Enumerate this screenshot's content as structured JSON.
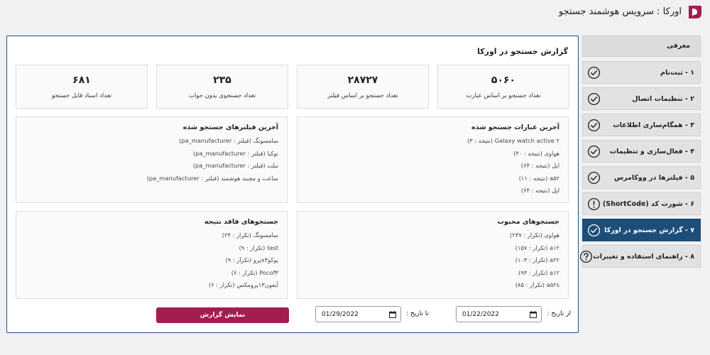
{
  "app": {
    "title": "اورکا : سرویس هوشمند جستجو"
  },
  "sidebar": {
    "header": "معرفی",
    "items": [
      {
        "label": "۱ - ثبت‌نام",
        "icon": "check-circle-icon",
        "active": false
      },
      {
        "label": "۲ - تنظیمات اتصال",
        "icon": "check-circle-icon",
        "active": false
      },
      {
        "label": "۳ - همگام‌سازی اطلاعات",
        "icon": "check-circle-icon",
        "active": false
      },
      {
        "label": "۴ - فعال‌سازی و تنظیمات",
        "icon": "check-circle-icon",
        "active": false
      },
      {
        "label": "۵ - فیلترها در ووکامرس",
        "icon": "check-circle-icon",
        "active": false
      },
      {
        "label": "۶ - شورت کد (ShortCode)",
        "icon": "exclamation-circle-icon",
        "active": false
      },
      {
        "label": "۷ - گزارش جستجو در اورکا",
        "icon": "check-circle-icon",
        "active": true
      },
      {
        "label": "۸ - راهنمای استفاده و تغییرات",
        "icon": "question-circle-icon",
        "active": false
      }
    ]
  },
  "main": {
    "title": "گزارش جستجو در اورکا",
    "stats": [
      {
        "value": "۵۰۶۰",
        "label": "تعداد جستجو بر اساس عبارت"
      },
      {
        "value": "۲۸۷۲۷",
        "label": "تعداد جستجو بر اساس فیلتر"
      },
      {
        "value": "۲۳۵",
        "label": "تعداد جستجوی بدون جواب"
      },
      {
        "value": "۶۸۱",
        "label": "تعداد اسناد قابل جستجو"
      }
    ],
    "latest_phrases": {
      "title": "آخرین عبارات جستجو شده",
      "rows": [
        "Galaxy watch active ۲ (نتیجه : ۳)",
        "هواوی (نتیجه : ۴۰)",
        "اپل (نتیجه : ۶۴)",
        "a۵۲ (نتیجه : ۱۱)",
        "اپل (نتیجه : ۶۴)"
      ]
    },
    "latest_filters": {
      "title": "آخرین فیلترهای جستجو شده",
      "rows": [
        "سامسونگ (فیلتر : pa_manufacturer)",
        "نوکیا (فیلتر : pa_manufacturer)",
        "تبلت (فیلتر : pa_manufacturer)",
        "ساعت و مچبند هوشمند (فیلتر : pa_manufacturer)"
      ]
    },
    "popular": {
      "title": "جستجوهای محبوب",
      "rows": [
        "هواوی (تکرار : ۲۳۷)",
        "a۱۲ (تکرار : ۱۵۷)",
        "a۲۲ (تکرار : ۱۰۳)",
        "a۱۲ (تکرار : ۹۳)",
        "a۵۲s (تکرار : ۸۵)"
      ]
    },
    "no_result": {
      "title": "جستجوهای فاقد نتیجه",
      "rows": [
        "سامسونگ (تکرار : ۲۴)",
        "test (تکرار : ۹)",
        "پوکوx۳پرو (تکرار : ۹)",
        "Pocof۳ (تکرار : ۶)",
        "آیفون۱۳پرومکس (تکرار : ۶)"
      ]
    },
    "filter": {
      "from_label": "از تاریخ :",
      "from_value": "01/22/2022",
      "to_label": "تا تاریخ :",
      "to_value": "01/29/2022",
      "submit_label": "نمایش گزارش"
    }
  },
  "colors": {
    "accent": "#1d4e79",
    "button": "#a31d4e",
    "logo": "#a31d4e"
  }
}
